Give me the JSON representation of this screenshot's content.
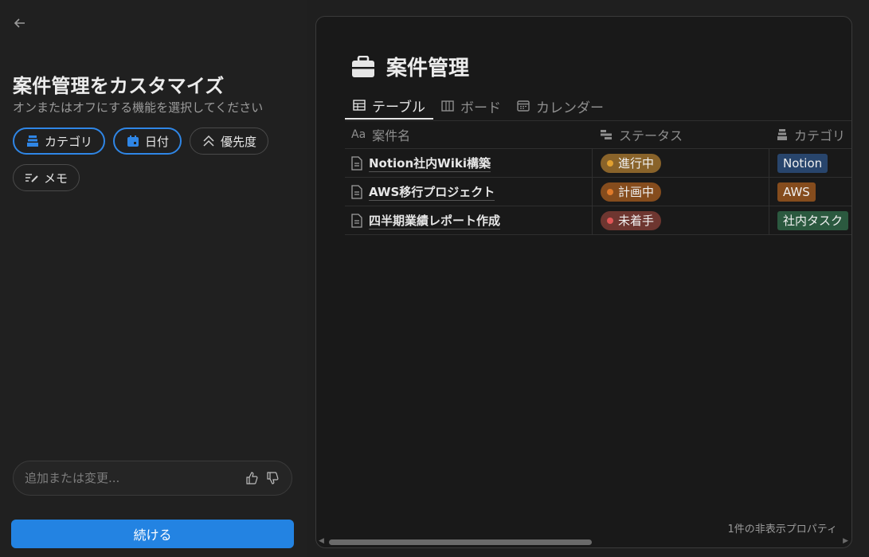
{
  "panel": {
    "back_icon": "arrow-left-icon",
    "title": "案件管理をカスタマイズ",
    "subtitle": "オンまたはオフにする機能を選択してください",
    "chips": [
      {
        "label": "カテゴリ",
        "icon": "stack-icon",
        "on": true
      },
      {
        "label": "日付",
        "icon": "calendar-icon",
        "on": true
      },
      {
        "label": "優先度",
        "icon": "double-chevron-up-icon",
        "on": false
      },
      {
        "label": "メモ",
        "icon": "edit-lines-icon",
        "on": false
      }
    ],
    "feedback_placeholder": "追加または変更...",
    "continue_label": "続ける"
  },
  "preview": {
    "title": "案件管理",
    "title_icon": "briefcase-icon",
    "tabs": [
      {
        "label": "テーブル",
        "icon": "table-icon",
        "active": true
      },
      {
        "label": "ボード",
        "icon": "board-icon",
        "active": false
      },
      {
        "label": "カレンダー",
        "icon": "calendar-icon",
        "active": false
      }
    ],
    "columns": {
      "name": "案件名",
      "name_prefix": "Aa",
      "status": "ステータス",
      "category": "カテゴリ"
    },
    "rows": [
      {
        "name": "Notion社内Wiki構築",
        "status": "進行中",
        "category": "Notion"
      },
      {
        "name": "AWS移行プロジェクト",
        "status": "計画中",
        "category": "AWS"
      },
      {
        "name": "四半期業績レポート作成",
        "status": "未着手",
        "category": "社内タスク"
      }
    ],
    "hidden_props": "1件の非表示プロパティ"
  },
  "colors": {
    "accent": "#2383e2",
    "status_in_progress_bg": "#89632a",
    "status_in_progress_dot": "#e0a030",
    "status_planned_bg": "#854c1d",
    "status_planned_dot": "#e07a2a",
    "status_not_started_bg": "#6e3630",
    "status_not_started_dot": "#e05555",
    "tag_notion_bg": "#28456c",
    "tag_aws_bg": "#854c1d",
    "tag_internal_bg": "#2b593f"
  }
}
